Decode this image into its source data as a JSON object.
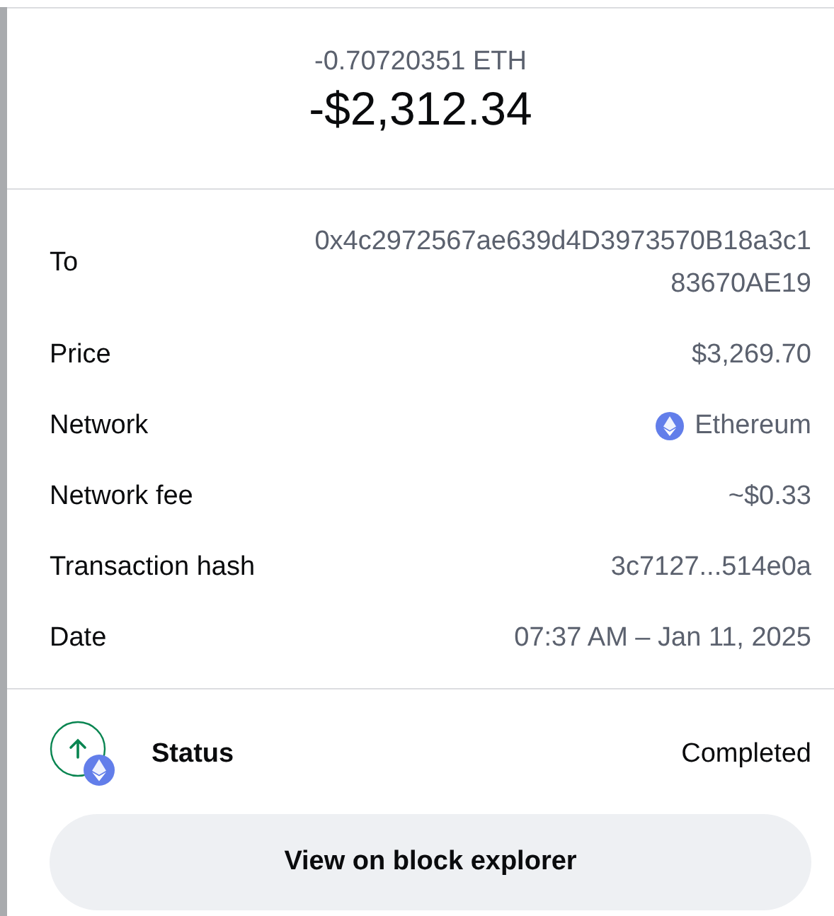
{
  "amount": {
    "crypto": "-0.70720351 ETH",
    "fiat": "-$2,312.34"
  },
  "details": [
    {
      "label": "To",
      "value": "0x4c2972567ae639d4D3973570B18a3c183670AE19",
      "kind": "address"
    },
    {
      "label": "Price",
      "value": "$3,269.70",
      "kind": "text"
    },
    {
      "label": "Network",
      "value": "Ethereum",
      "kind": "network"
    },
    {
      "label": "Network fee",
      "value": "~$0.33",
      "kind": "text"
    },
    {
      "label": "Transaction hash",
      "value": "3c7127...514e0a",
      "kind": "text"
    },
    {
      "label": "Date",
      "value": "07:37 AM – Jan 11, 2025",
      "kind": "text"
    }
  ],
  "status": {
    "label": "Status",
    "value": "Completed",
    "outgoing": true
  },
  "button": "View on block explorer"
}
